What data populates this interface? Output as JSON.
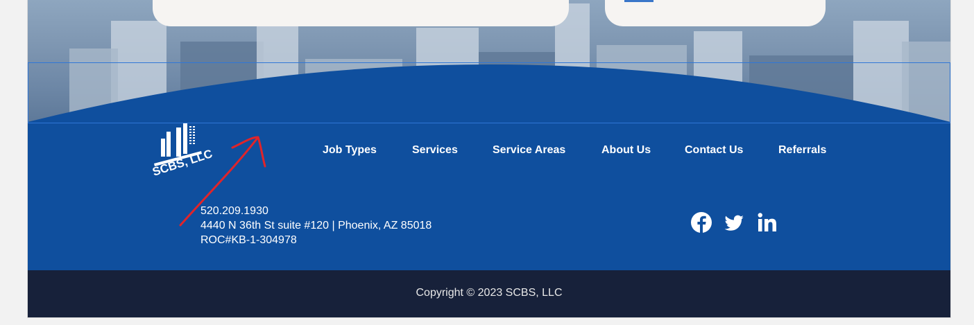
{
  "colors": {
    "footer_blue": "#0f4f9e",
    "copyright_bg": "#17213a",
    "annotation_red": "#e0242a"
  },
  "logo": {
    "text": "SCBS, LLC"
  },
  "nav": {
    "items": [
      {
        "label": "Job Types"
      },
      {
        "label": "Services"
      },
      {
        "label": "Service Areas"
      },
      {
        "label": "About Us"
      },
      {
        "label": "Contact Us"
      },
      {
        "label": "Referrals"
      }
    ]
  },
  "contact": {
    "phone": "520.209.1930",
    "address": "4440 N 36th St suite #120 | Phoenix, AZ 85018",
    "license": "ROC#KB-1-304978"
  },
  "social": {
    "icons": [
      "facebook-icon",
      "twitter-icon",
      "linkedin-icon"
    ]
  },
  "footer": {
    "copyright": "Copyright © 2023 SCBS, LLC"
  }
}
